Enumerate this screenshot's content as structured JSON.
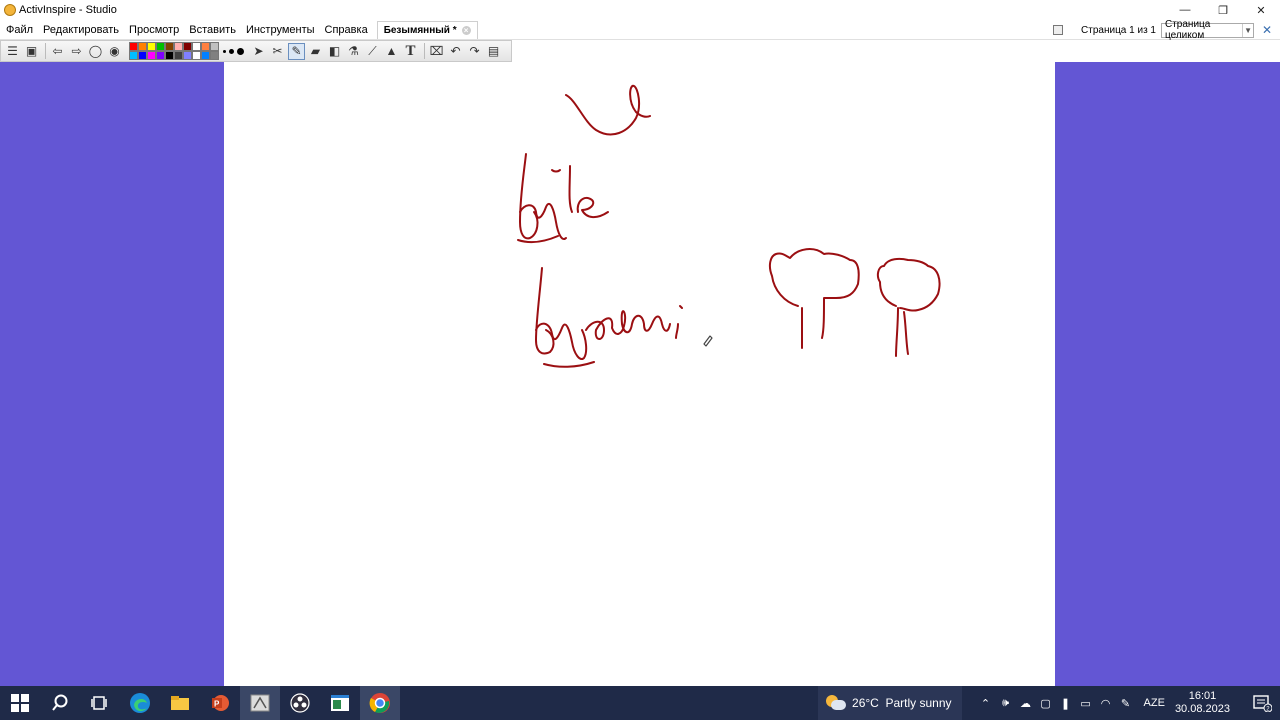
{
  "window": {
    "title": "ActivInspire - Studio",
    "controls": {
      "minimize": "—",
      "restore": "❐",
      "close": "✕"
    }
  },
  "menu": {
    "items": [
      "Файл",
      "Редактировать",
      "Просмотр",
      "Вставить",
      "Инструменты",
      "Справка"
    ],
    "document_tab": "Безымянный *"
  },
  "page_controls": {
    "page_indicator": "Страница 1 из 1",
    "zoom_value": "Страница целиком"
  },
  "toolbar": {
    "palette_colors": [
      "#ff0000",
      "#ff8000",
      "#ffff00",
      "#00c000",
      "#804000",
      "#ffb0b0",
      "#800000",
      "#ffffff",
      "#ff8040",
      "#c0c0c0",
      "#00c0ff",
      "#0000ff",
      "#ff00ff",
      "#8000ff",
      "#000000",
      "#404040",
      "#8080ff",
      "#ffffff",
      "#0080ff",
      "#808080"
    ],
    "tools": [
      "select-icon",
      "pen-tools-icon",
      "pen-icon",
      "highlighter-icon",
      "eraser-icon",
      "fill-icon",
      "magic-ink-icon",
      "shapes-icon",
      "text-icon",
      "clear-icon",
      "undo-icon",
      "redo-icon",
      "page-icon"
    ]
  },
  "canvas": {
    "ink_color": "#9b0f12",
    "workspace_color": "#6356d4"
  },
  "taskbar": {
    "apps": [
      "start-icon",
      "search-icon",
      "task-view-icon",
      "edge-icon",
      "file-explorer-icon",
      "powerpoint-icon",
      "activinspire-icon",
      "obs-icon",
      "window-app-icon",
      "chrome-icon"
    ],
    "weather": "26°C  Partly sunny",
    "language": "AZE",
    "time": "16:01",
    "date": "30.08.2023",
    "notification_count": "2"
  }
}
